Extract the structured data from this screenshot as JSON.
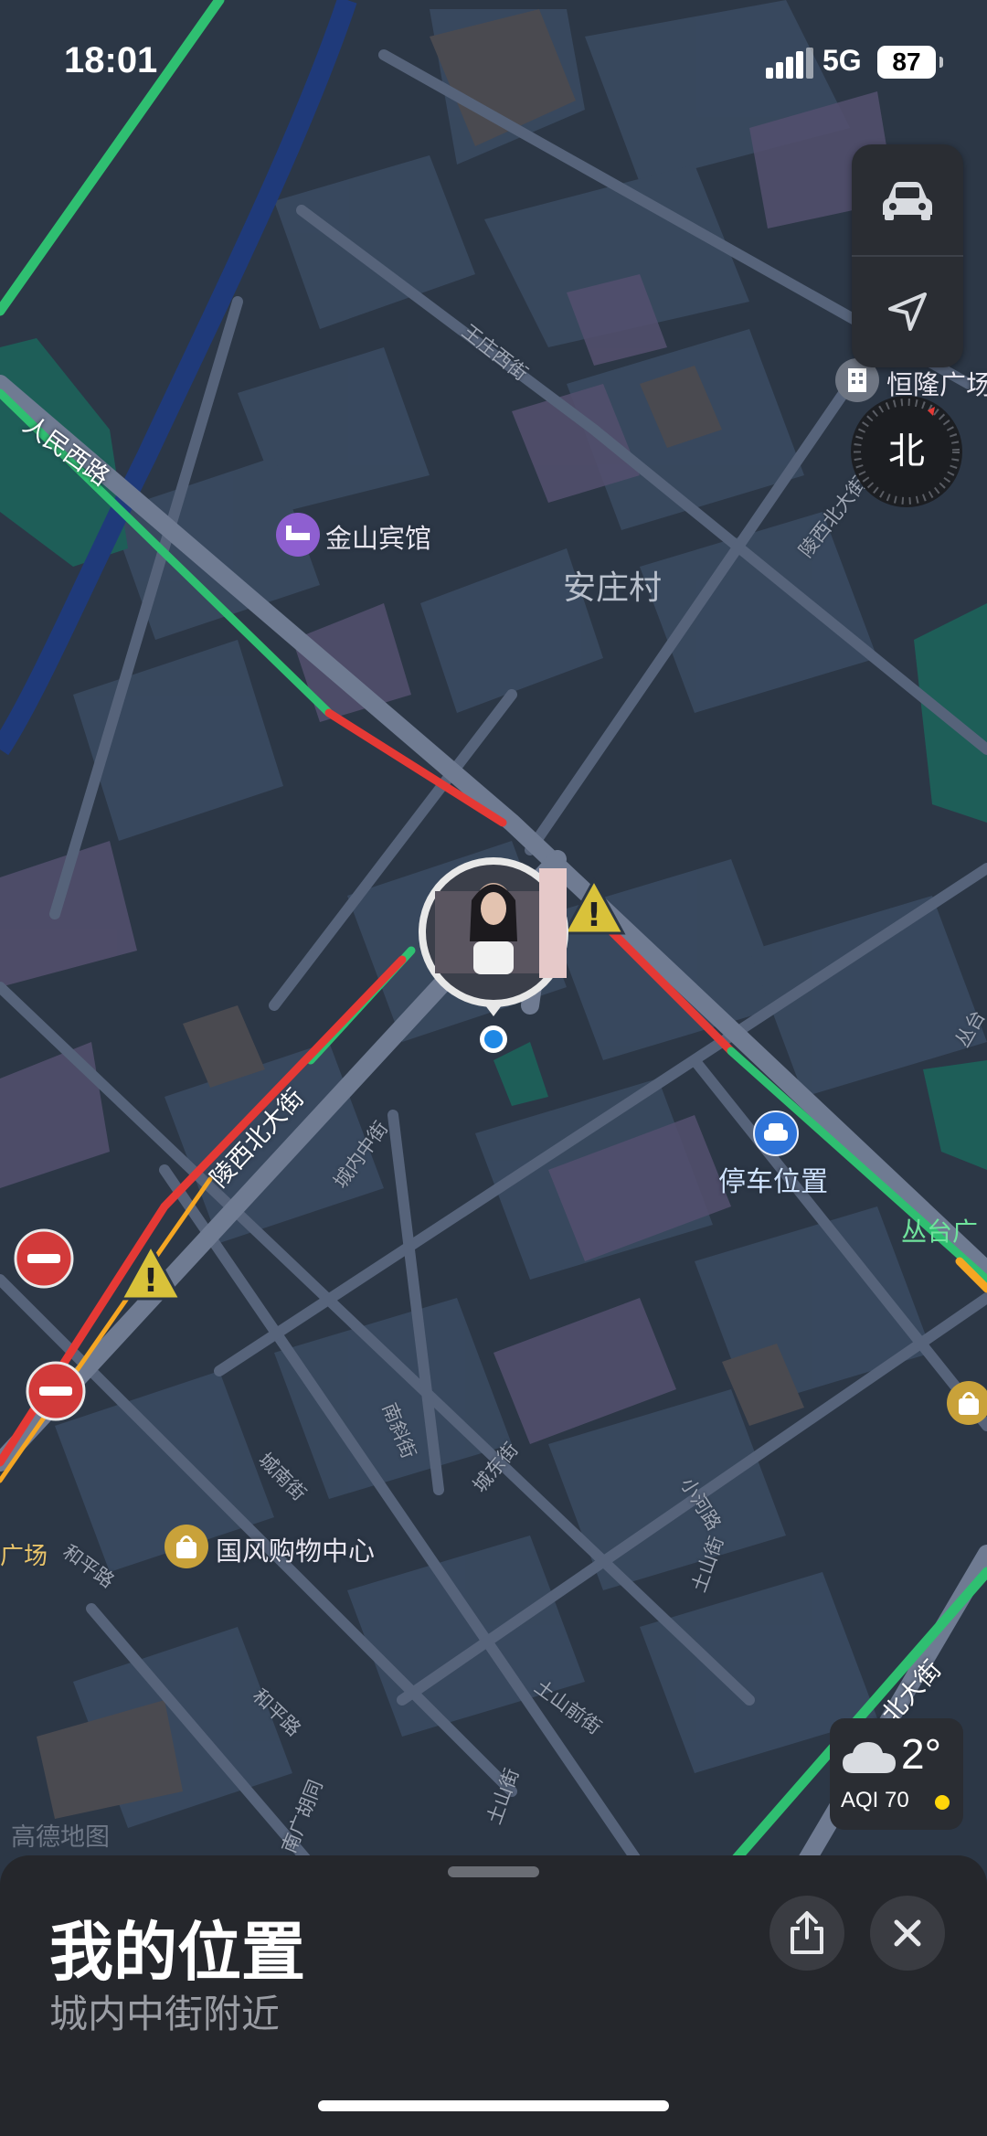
{
  "status_bar": {
    "time": "18:01",
    "network": "5G",
    "battery": "87"
  },
  "map": {
    "village": "安庄村",
    "pois": [
      {
        "name": "金山宾馆",
        "type": "hotel"
      },
      {
        "name": "恒隆广场",
        "type": "building"
      },
      {
        "name": "国风购物中心",
        "type": "shopping"
      },
      {
        "name": "停车位置",
        "type": "parking"
      }
    ],
    "roads_major": [
      "人民西路",
      "陵西北大街",
      "丛台广"
    ],
    "streets": [
      "王庄西街",
      "陵西北大街",
      "城内中街",
      "南斜街",
      "城南街",
      "城东街",
      "和平路",
      "小河路",
      "土山街",
      "土山前街",
      "南广胡同",
      "丛台北大街",
      "丛台"
    ],
    "edge_labels": [
      "广场",
      "广"
    ],
    "watermark": "高德地图"
  },
  "weather": {
    "temperature": "2°",
    "aqi": "AQI 70"
  },
  "sheet": {
    "title": "我的位置",
    "subtitle": "城内中街附近"
  },
  "icons": [
    "car-icon",
    "location-arrow-icon",
    "compass-icon",
    "hotel-icon",
    "building-icon",
    "shopping-bag-icon",
    "parking-car-icon",
    "warning-icon",
    "no-entry-icon",
    "cloud-icon",
    "share-icon",
    "close-icon",
    "user-avatar"
  ],
  "colors": {
    "traffic_free": "#2fbf71",
    "traffic_jam": "#e53935",
    "traffic_slow": "#f5a623",
    "map_bg": "#2c3746",
    "user_dot": "#1e88e5"
  }
}
